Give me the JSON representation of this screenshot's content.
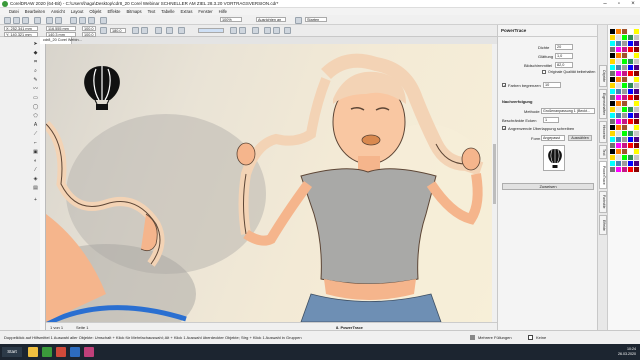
{
  "window": {
    "title": "CorelDRAW 2020 (64-Bit) - C:\\Users\\haga\\Desktop\\cdr8_20 Corel Webinar SCHNELLER AM ZIEL 28.3.20 VORTRAGSVERSION.cdr*"
  },
  "menu": [
    "Datei",
    "Bearbeiten",
    "Ansicht",
    "Layout",
    "Objekt",
    "Effekte",
    "Bitmaps",
    "Text",
    "Tabelle",
    "Extras",
    "Fenster",
    "Hilfe"
  ],
  "toolbar": {
    "zoom_value": "100%",
    "snap_label": "Ausrichten an",
    "start_label": "Starten"
  },
  "propertybar": {
    "x": "X: 252,341 mm",
    "y": "Y: 140,321 mm",
    "w": "116,555 mm",
    "h": "140,3 mm",
    "scale_w": "100,0",
    "scale_h": "100,0",
    "angle": "180,0"
  },
  "document_tab": "cdr8_20 Corel Webin...",
  "docker": {
    "title": "PowerTrace",
    "detail_label": "Dichte",
    "detail_value": "20",
    "smooth_label": "Glättung",
    "smooth_value": "1,0",
    "image_size_label": "Bildschirmmittel",
    "image_size_value": "82,0",
    "keep_quality_label": "Originale Qualität beibehalten",
    "colors_label": "Farben begrenzen",
    "colors_value": "10",
    "section_label": "Nachverfolgung",
    "method_label": "Methode",
    "method_value": "Großenanpassung 1 (Beckt...",
    "limit_label": "Beschränkte Ecken",
    "limit_value": "1",
    "overlap_label": "Angrenzende Überlappung schreiben",
    "shape_label": "Form",
    "shape_value": "Angepasst",
    "shape_button": "Auswählen",
    "apply_button": "Zuweisen"
  },
  "side_tabs": [
    "Objekte",
    "Eigenschaften",
    "Hinweise",
    "Text",
    "PowerTrace",
    "Farbstile",
    "Effekte"
  ],
  "page_nav": "1 von 1",
  "page_label": "Seite 1",
  "page_tab_active": "8. PowerTrace",
  "status": {
    "hint": "Doppelklick auf Hilfsmittel 1 Auswahl aller Objekte: Umschalt + Klick für Mehrfachauswahl; Alt + Klick 1 Auswahl überdeckter Objekte; Strg + Klick 1 Auswahl in Gruppen",
    "fill_label": "Mehrere Füllungen",
    "outline_label": "Keine"
  },
  "taskbar": {
    "start": "Start",
    "time": "10:24",
    "date": "26.03.2020"
  },
  "colors": {
    "accent": "#3b9a3b",
    "shirt": "#a9a9a7",
    "hair": "#f3d3b5",
    "skin": "#f5b58c",
    "jeans": "#6e8fb4"
  },
  "icons": [
    "balloon-icon",
    "pick-tool-icon",
    "shape-tool-icon",
    "zoom-icon",
    "freehand-icon",
    "rectangle-icon",
    "ellipse-icon",
    "text-icon",
    "fill-icon"
  ]
}
